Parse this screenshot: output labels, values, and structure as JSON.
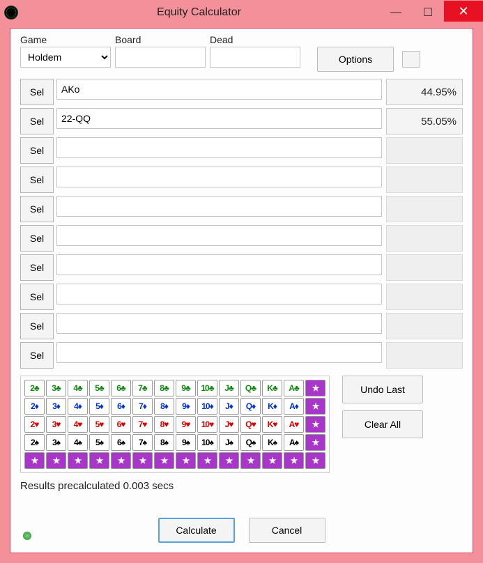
{
  "titlebar": {
    "title": "Equity Calculator"
  },
  "toprow": {
    "game_label": "Game",
    "board_label": "Board",
    "dead_label": "Dead",
    "game_value": "Holdem",
    "board_value": "",
    "dead_value": "",
    "options_label": "Options"
  },
  "rows": [
    {
      "sel": "Sel",
      "range": "AKo",
      "equity": "44.95%"
    },
    {
      "sel": "Sel",
      "range": "22-QQ",
      "equity": "55.05%"
    },
    {
      "sel": "Sel",
      "range": "",
      "equity": ""
    },
    {
      "sel": "Sel",
      "range": "",
      "equity": ""
    },
    {
      "sel": "Sel",
      "range": "",
      "equity": ""
    },
    {
      "sel": "Sel",
      "range": "",
      "equity": ""
    },
    {
      "sel": "Sel",
      "range": "",
      "equity": ""
    },
    {
      "sel": "Sel",
      "range": "",
      "equity": ""
    },
    {
      "sel": "Sel",
      "range": "",
      "equity": ""
    },
    {
      "sel": "Sel",
      "range": "",
      "equity": ""
    }
  ],
  "cardgrid": {
    "ranks": [
      "2",
      "3",
      "4",
      "5",
      "6",
      "7",
      "8",
      "9",
      "10",
      "J",
      "Q",
      "K",
      "A"
    ],
    "suits": [
      {
        "name": "club",
        "symbol": "♣"
      },
      {
        "name": "diamond",
        "symbol": "♦"
      },
      {
        "name": "heart",
        "symbol": "♥"
      },
      {
        "name": "spade",
        "symbol": "♠"
      }
    ],
    "star": "★"
  },
  "side": {
    "undo": "Undo Last",
    "clear": "Clear All"
  },
  "status": "Results precalculated 0.003 secs",
  "footer": {
    "calculate": "Calculate",
    "cancel": "Cancel"
  }
}
